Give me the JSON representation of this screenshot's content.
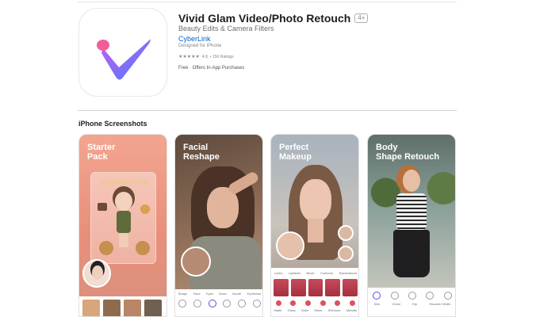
{
  "app": {
    "title": "Vivid Glam Video/Photo Retouch",
    "age_rating": "4+",
    "subtitle": "Beauty Edits & Camera Filters",
    "developer": "CyberLink",
    "designed_for": "Designed for iPhone",
    "rating": {
      "stars_display": "★★★★★",
      "average": "4.8",
      "count_label": "• 150 Ratings"
    },
    "price": "Free · Offers In-App Purchases",
    "icon_colors": {
      "check_start": "#c65cf0",
      "check_end": "#4a7cff",
      "dot": "#f25c9a"
    }
  },
  "screenshots": {
    "section_title": "iPhone Screenshots",
    "items": [
      {
        "caption": "Starter\nPack",
        "card_title": "STARTER PACK"
      },
      {
        "caption": "Facial\nReshape",
        "tools": [
          "Shape",
          "Face",
          "Eyes",
          "Nose",
          "Mouth",
          "Eyebrows"
        ]
      },
      {
        "caption": "Perfect\nMakeup",
        "tabs": [
          "Looks",
          "Lipsticks",
          "Blush",
          "Contours",
          "Eyeshadows"
        ],
        "labels": [
          "Matte",
          "Gloss",
          "Satin",
          "Sheer",
          "Shimmer",
          "Metallic"
        ]
      },
      {
        "caption": "Body\nShape Retouch",
        "tools": [
          "Slim",
          "Chest",
          "Hip",
          "Shoulder Width"
        ]
      }
    ]
  }
}
